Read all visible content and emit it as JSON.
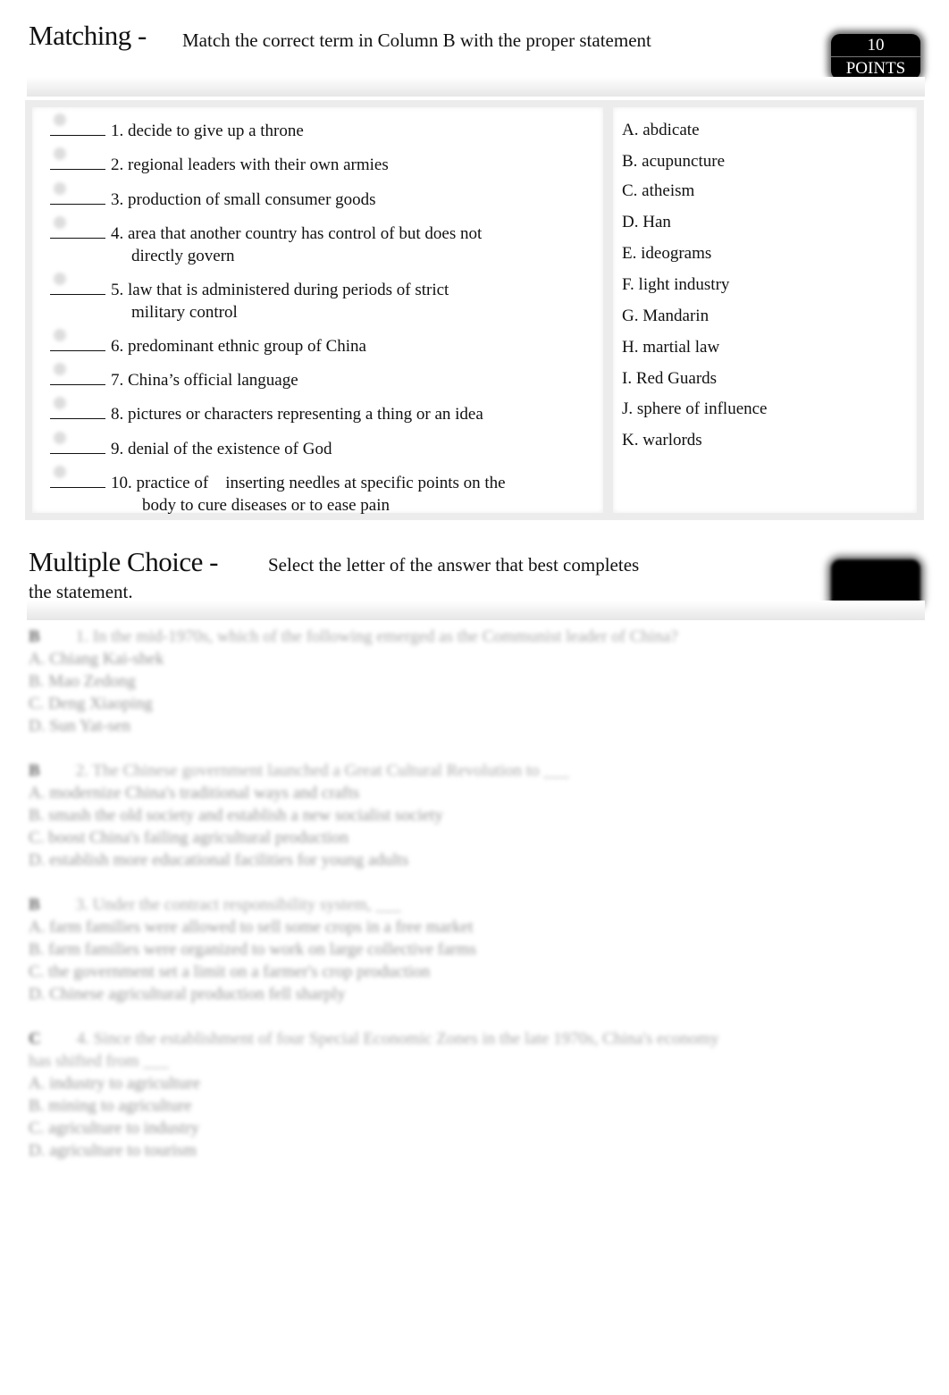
{
  "matching": {
    "title": "Matching -",
    "instruction": "Match the correct term in Column B with the proper statement",
    "points_value": "10",
    "points_label": "POINTS",
    "blank": "______",
    "statements": [
      {
        "line1": "1. decide to give up a throne",
        "line2": ""
      },
      {
        "line1": "2. regional leaders with their own armies",
        "line2": ""
      },
      {
        "line1": "3. production of small consumer goods",
        "line2": ""
      },
      {
        "line1": "4. area that another country has control of but does not",
        "line2": "directly govern"
      },
      {
        "line1": "5. law that is administered during periods of strict",
        "line2": "military control"
      },
      {
        "line1": "6. predominant ethnic group of China",
        "line2": ""
      },
      {
        "line1": "7. China’s official language",
        "line2": ""
      },
      {
        "line1": "8. pictures or characters representing a thing or an idea",
        "line2": ""
      },
      {
        "line1": "9. denial of the existence of God",
        "line2": ""
      },
      {
        "line1": "10. practice of    inserting needles at specific points on the",
        "line2": "body to cure diseases or to ease pain"
      }
    ],
    "terms": [
      "A. abdicate",
      "B. acupuncture",
      "C. atheism",
      "D. Han",
      "E. ideograms",
      "F. light industry",
      "G. Mandarin",
      "H. martial law",
      "I. Red Guards",
      "J. sphere of influence",
      "K. warlords"
    ]
  },
  "multiple_choice": {
    "title": "Multiple Choice -",
    "instruction": "Select the letter of the answer that best completes",
    "instruction_cont": "the statement.",
    "questions": [
      {
        "num": "B",
        "text": "1. In the mid-1970s, which of the following emerged as the Communist leader of China?",
        "cont": "",
        "options": [
          "A. Chiang Kai-shek",
          "B. Mao Zedong",
          "C. Deng Xiaoping",
          "D. Sun Yat-sen"
        ]
      },
      {
        "num": "B",
        "text": "2. The Chinese government launched a Great Cultural Revolution to ___",
        "cont": "",
        "options": [
          "A. modernize China's traditional ways and crafts",
          "B. smash the old society and establish a new socialist society",
          "C. boost China's failing agricultural production",
          "D. establish more educational facilities for young adults"
        ]
      },
      {
        "num": "B",
        "text": "3. Under the contract responsibility system, ___",
        "cont": "",
        "options": [
          "A. farm families were allowed to sell some crops in a free market",
          "B. farm families were organized to work on large collective farms",
          "C. the government set a limit on a farmer's crop production",
          "D. Chinese agricultural production fell sharply"
        ]
      },
      {
        "num": "C",
        "text": "4. Since the establishment of four Special Economic Zones in the late 1970s, China's economy",
        "cont": "has shifted from ___",
        "options": [
          "A. industry to agriculture",
          "B. mining to agriculture",
          "C. agriculture to industry",
          "D. agriculture to tourism"
        ]
      }
    ]
  }
}
